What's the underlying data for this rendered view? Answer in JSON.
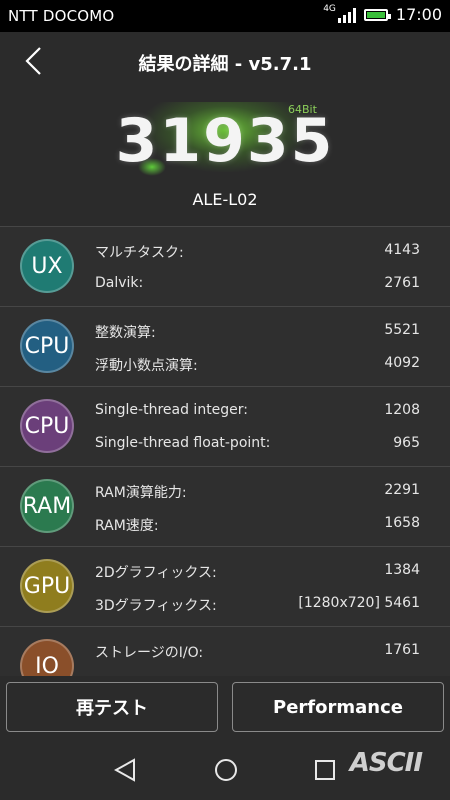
{
  "status_bar": {
    "carrier": "NTT DOCOMO",
    "network_type": "4G",
    "time": "17:00"
  },
  "header": {
    "back_icon": "chevron-left-icon",
    "title": "結果の詳細 - v5.7.1"
  },
  "score": {
    "value": "31935",
    "bit_label": "64Bit",
    "device": "ALE-L02"
  },
  "categories": [
    {
      "badge": "UX",
      "color": "#1f7b73",
      "rows": [
        {
          "label": "マルチタスク:",
          "value": "4143"
        },
        {
          "label": "Dalvik:",
          "value": "2761"
        }
      ]
    },
    {
      "badge": "CPU",
      "color": "#235f82",
      "rows": [
        {
          "label": "整数演算:",
          "value": "5521"
        },
        {
          "label": "浮動小数点演算:",
          "value": "4092"
        }
      ]
    },
    {
      "badge": "CPU",
      "color": "#6b3f7a",
      "rows": [
        {
          "label": "Single-thread integer:",
          "value": "1208"
        },
        {
          "label": "Single-thread float-point:",
          "value": "965"
        }
      ]
    },
    {
      "badge": "RAM",
      "color": "#2b7a4f",
      "rows": [
        {
          "label": "RAM演算能力:",
          "value": "2291"
        },
        {
          "label": "RAM速度:",
          "value": "1658"
        }
      ]
    },
    {
      "badge": "GPU",
      "color": "#8f7d1e",
      "rows": [
        {
          "label": "2Dグラフィックス:",
          "value": "1384"
        },
        {
          "label": "3Dグラフィックス:",
          "value": "[1280x720] 5461"
        }
      ]
    },
    {
      "badge": "IO",
      "color": "#8a4f2a",
      "rows": [
        {
          "label": "ストレージのI/O:",
          "value": "1761"
        }
      ]
    }
  ],
  "buttons": {
    "retest": "再テスト",
    "performance": "Performance"
  },
  "navbar": {
    "back": "back-triangle-icon",
    "home": "home-circle-icon",
    "recents": "recents-square-icon",
    "watermark": "ASCII"
  }
}
